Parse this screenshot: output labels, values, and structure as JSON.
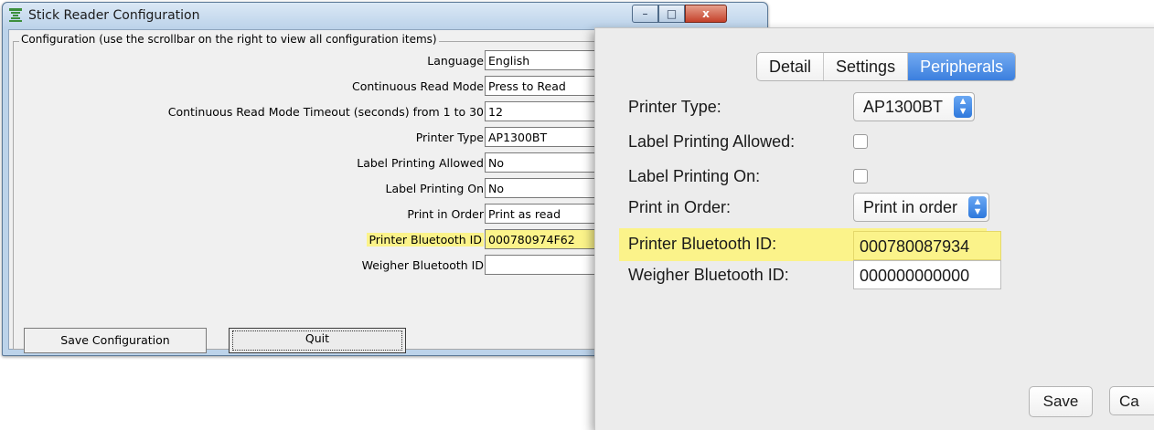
{
  "windows_app": {
    "title": "Stick Reader Configuration",
    "controls": {
      "minimize": "–",
      "maximize": "□",
      "close": "x"
    },
    "group_title": "Configuration (use the scrollbar on the right to view all configuration items)",
    "rows": [
      {
        "label": "Language",
        "value": "English"
      },
      {
        "label": "Continuous Read Mode",
        "value": "Press to Read"
      },
      {
        "label": "Continuous Read Mode Timeout (seconds) from 1 to 30",
        "value": "12"
      },
      {
        "label": "Printer Type",
        "value": "AP1300BT"
      },
      {
        "label": "Label Printing Allowed",
        "value": "No"
      },
      {
        "label": "Label Printing On",
        "value": "No"
      },
      {
        "label": "Print in Order",
        "value": "Print as read"
      },
      {
        "label": "Printer Bluetooth ID",
        "value": "000780974F62"
      },
      {
        "label": "Weigher Bluetooth ID",
        "value": ""
      }
    ],
    "save_button": "Save Configuration",
    "quit_button": "Quit",
    "highlight_color": "#fbf38a"
  },
  "mac_app": {
    "tabs": [
      {
        "label": "Detail",
        "active": false
      },
      {
        "label": "Settings",
        "active": false
      },
      {
        "label": "Peripherals",
        "active": true
      }
    ],
    "fields": {
      "printer_type": {
        "label": "Printer Type:",
        "value": "AP1300BT"
      },
      "label_printing_allowed": {
        "label": "Label Printing Allowed:",
        "checked": false
      },
      "label_printing_on": {
        "label": "Label Printing On:",
        "checked": false
      },
      "print_in_order": {
        "label": "Print in Order:",
        "value": "Print in order"
      },
      "printer_bluetooth_id": {
        "label": "Printer Bluetooth ID:",
        "value": "000780087934"
      },
      "weigher_bluetooth_id": {
        "label": "Weigher Bluetooth ID:",
        "value": "000000000000"
      }
    },
    "save_button": "Save",
    "cancel_button": "Ca",
    "accent_color": "#3b7fde"
  }
}
